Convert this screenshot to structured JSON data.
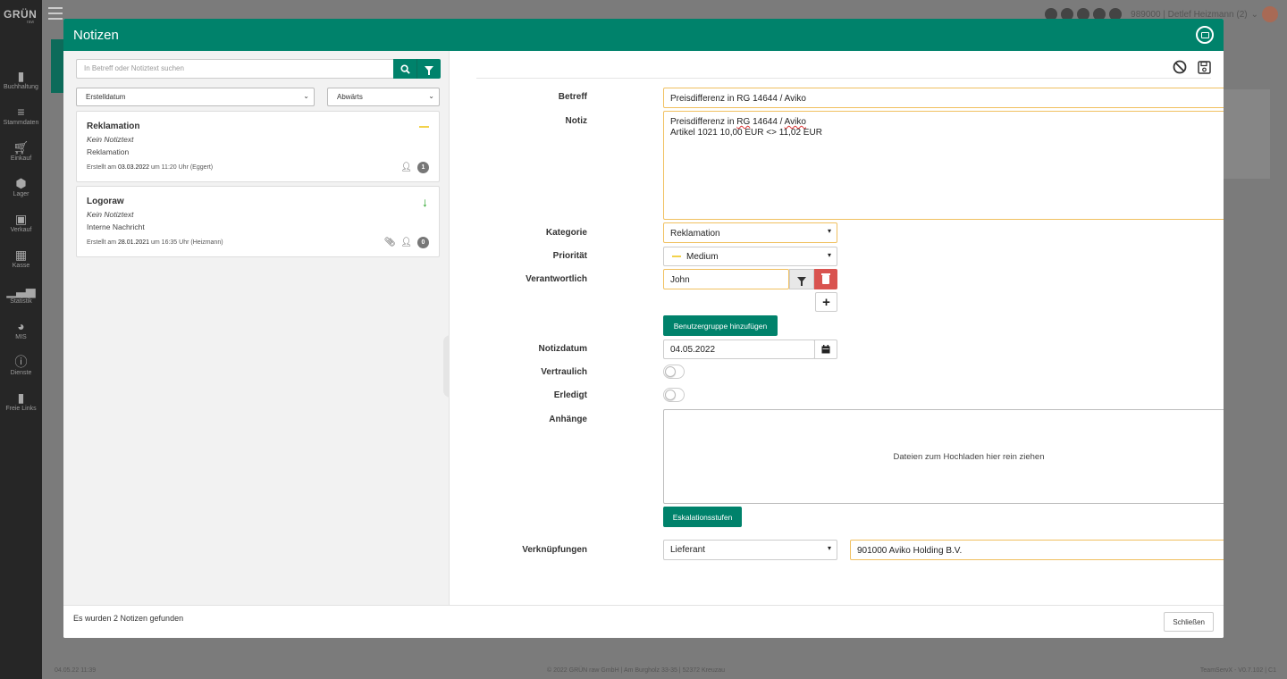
{
  "app": {
    "logo": "GRÜN",
    "logo_sub": "raw",
    "user": "989000 | Detlef Heizmann (2)",
    "footer_left": "04.05.22 11:39",
    "footer_center": "© 2022 GRÜN raw GmbH | Am Burgholz 33-35 | 52372 Kreuzau",
    "footer_right": "TeamServX - V0.7.102 | C1"
  },
  "sidebar": {
    "items": [
      {
        "label": "Buchhaltung",
        "icon": "book-icon"
      },
      {
        "label": "Stammdaten",
        "icon": "database-icon"
      },
      {
        "label": "Einkauf",
        "icon": "cart-icon"
      },
      {
        "label": "Lager",
        "icon": "boxes-icon"
      },
      {
        "label": "Verkauf",
        "icon": "bag-icon"
      },
      {
        "label": "Kasse",
        "icon": "register-icon"
      },
      {
        "label": "Statistik",
        "icon": "chart-icon"
      },
      {
        "label": "MIS",
        "icon": "pie-icon"
      },
      {
        "label": "Dienste",
        "icon": "info-icon"
      },
      {
        "label": "Freie Links",
        "icon": "bookmark-icon"
      }
    ]
  },
  "modal": {
    "title": "Notizen",
    "search_placeholder": "In Betreff oder Notiztext suchen",
    "sort_field": "Erstelldatum",
    "sort_dir": "Abwärts",
    "notes": [
      {
        "title": "Reklamation",
        "text": "Kein Notiztext",
        "category": "Reklamation",
        "meta_prefix": "Erstellt am",
        "date": "03.03.2022",
        "meta_mid": "um 11:20 Uhr (Eggert)",
        "count": "1",
        "priority": "medium"
      },
      {
        "title": "Logoraw",
        "text": "Kein Notiztext",
        "category": "Interne Nachricht",
        "meta_prefix": "Erstellt am",
        "date": "28.01.2021",
        "meta_mid": "um 16:35 Uhr (Heizmann)",
        "count": "0",
        "priority": "low"
      }
    ],
    "footer_text": "Es wurden 2 Notizen gefunden",
    "close_label": "Schließen"
  },
  "form": {
    "betreff_label": "Betreff",
    "betreff_value": "Preisdifferenz in RG 14644 / Aviko",
    "notiz_label": "Notiz",
    "notiz_line1_a": "Preisdifferenz in ",
    "notiz_line1_b": "RG",
    "notiz_line1_c": " 14644 / ",
    "notiz_line1_d": "Aviko",
    "notiz_line2": "Artikel 1021 10,00 EUR <> 11,02 EUR",
    "kategorie_label": "Kategorie",
    "kategorie_value": "Reklamation",
    "prioritaet_label": "Priorität",
    "prioritaet_value": "Medium",
    "verantwortlich_label": "Verantwortlich",
    "verantwortlich_value": "John",
    "benutzergruppe_label": "Benutzergruppe hinzufügen",
    "notizdatum_label": "Notizdatum",
    "notizdatum_value": "04.05.2022",
    "vertraulich_label": "Vertraulich",
    "erledigt_label": "Erledigt",
    "anhaenge_label": "Anhänge",
    "dropzone_text": "Dateien zum Hochladen hier rein ziehen",
    "eskalation_label": "Eskalationsstufen",
    "verknuepfungen_label": "Verknüpfungen",
    "verknuepfung_type": "Lieferant",
    "verknuepfung_value": "901000 Aviko Holding B.V."
  },
  "colors": {
    "brand": "#00826b",
    "danger": "#d9534f",
    "focus_border": "#f0c060",
    "priority_medium": "#f2d24b",
    "priority_low": "#22a022"
  }
}
